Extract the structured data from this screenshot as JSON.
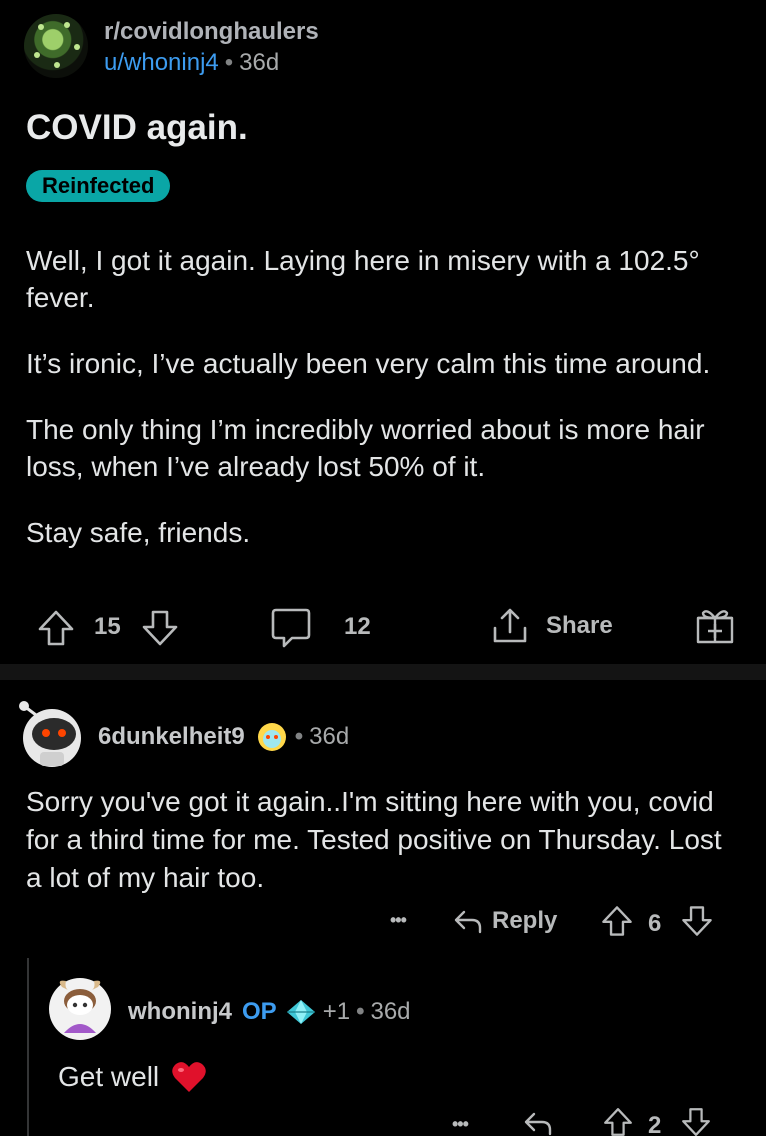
{
  "post": {
    "subreddit": "r/covidlonghaulers",
    "author": "u/whoninj4",
    "separator": "•",
    "age": "36d",
    "title": "COVID again.",
    "flair": "Reinfected",
    "paragraphs": [
      "Well, I got it again. Laying here in misery with a 102.5° fever.",
      "It’s ironic, I’ve actually been very calm this time around.",
      "The only thing I’m incredibly worried about is more hair loss, when I’ve already lost 50% of it.",
      "Stay safe, friends."
    ],
    "actions": {
      "votes": "15",
      "comments": "12",
      "share_label": "Share"
    }
  },
  "comment": {
    "username": "6dunkelheit9",
    "separator": "•",
    "age": "36d",
    "body": "Sorry you've got it again..I'm sitting here with you, covid for a third time for me. Tested positive on Thursday. Lost a lot of my hair too.",
    "more": "•••",
    "reply_label": "Reply",
    "votes": "6"
  },
  "reply": {
    "username": "whoninj4",
    "op_badge": "OP",
    "award_count": "+1",
    "separator": "•",
    "age": "36d",
    "body": "Get well",
    "body_emoji": "❤️",
    "more": "•••",
    "votes": "2"
  },
  "colors": {
    "background": "#000000",
    "link_blue": "#3d9cf0",
    "flair_teal": "#0aa6a6",
    "heart": "#e0112b"
  },
  "icons": [
    "upvote-icon",
    "downvote-icon",
    "comment-icon",
    "share-icon",
    "gift-award-icon",
    "reply-icon",
    "more-icon",
    "diamond-award-icon"
  ]
}
